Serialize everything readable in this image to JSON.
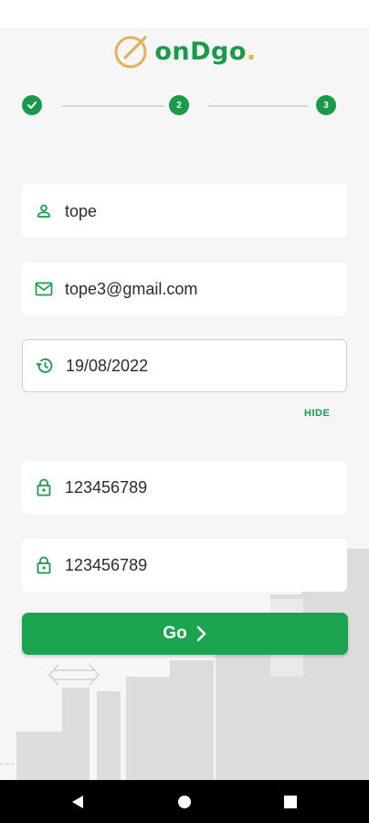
{
  "app": {
    "brand_prefix": "onDgo",
    "brand_suffix": "."
  },
  "stepper": {
    "steps": [
      {
        "label": "",
        "done": true
      },
      {
        "label": "2"
      },
      {
        "label": "3"
      }
    ]
  },
  "form": {
    "username": {
      "value": "tope",
      "icon": "person-icon"
    },
    "email": {
      "value": "tope3@gmail.com",
      "icon": "mail-icon"
    },
    "dob": {
      "value": "19/08/2022",
      "icon": "history-icon"
    },
    "hide_label": "HIDE",
    "password": {
      "value": "123456789",
      "icon": "lock-icon"
    },
    "confirm_password": {
      "value": "123456789",
      "icon": "lock-icon"
    }
  },
  "go_button": {
    "label": "Go",
    "icon": "chevron-right-icon"
  },
  "colors": {
    "primary": "#1a9b4a",
    "accent": "#e7b33a",
    "background": "#f6f6f6"
  },
  "navbar": {
    "items": [
      "back-icon",
      "home-icon",
      "recents-icon"
    ]
  }
}
